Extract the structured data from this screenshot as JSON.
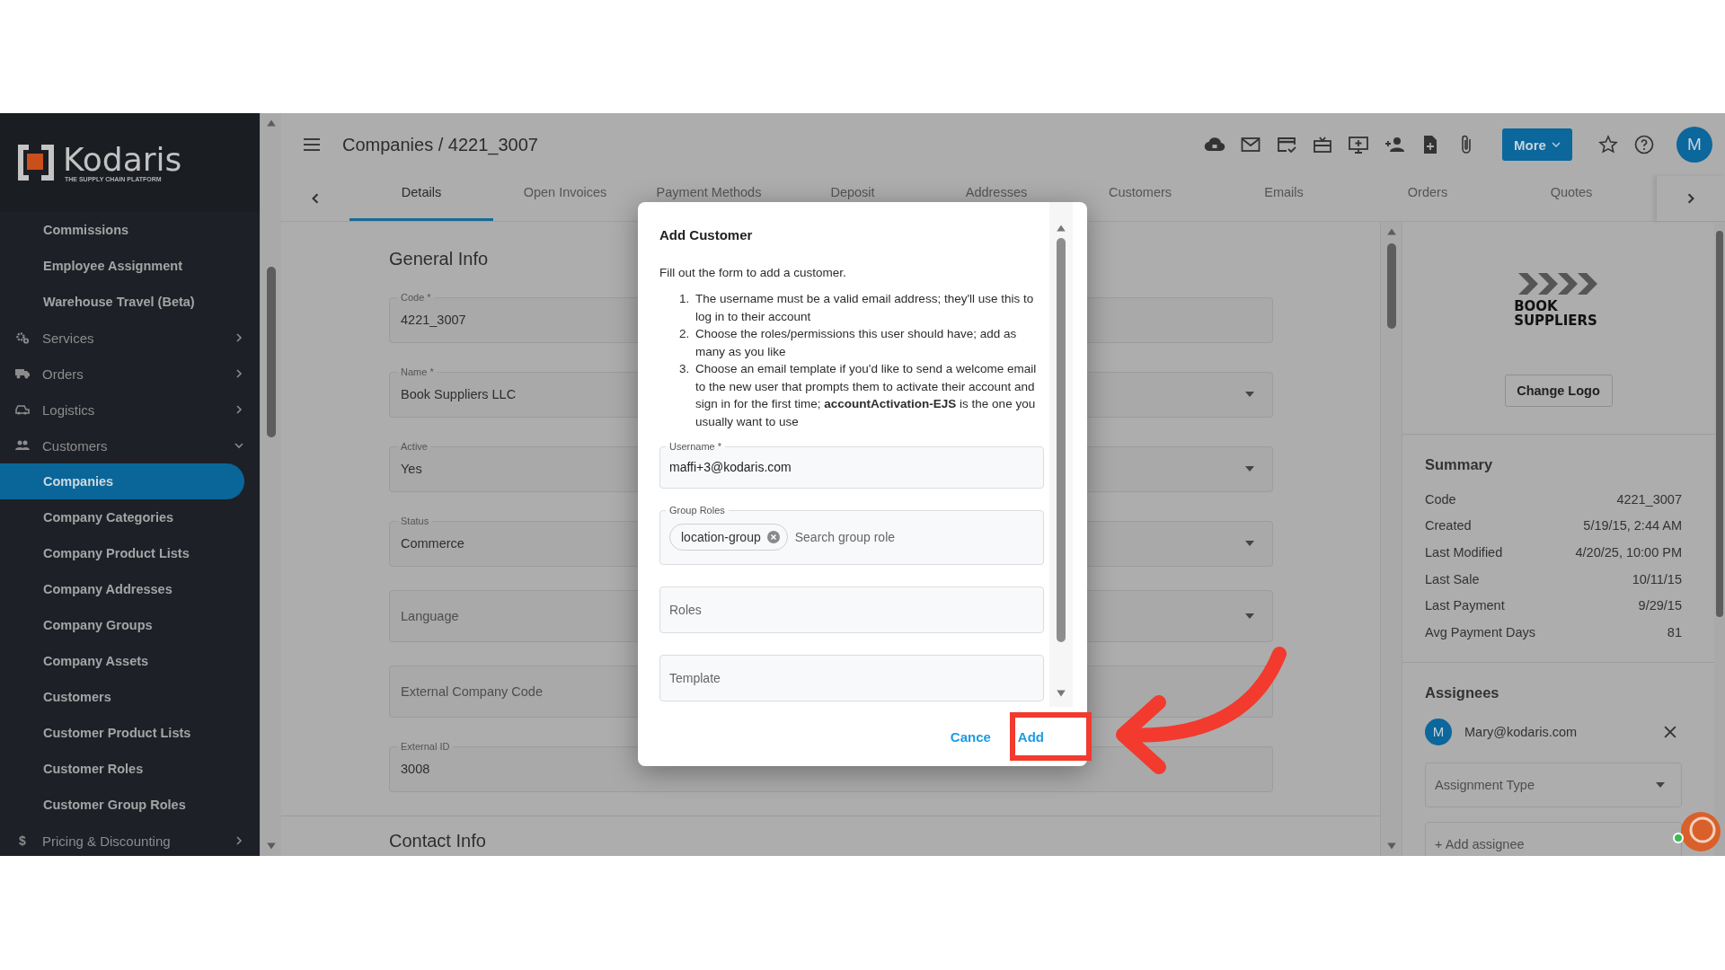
{
  "sidebar": {
    "logo": {
      "name": "Kodaris",
      "tagline": "THE SUPPLY CHAIN PLATFORM"
    },
    "items": [
      {
        "label": "Commissions",
        "kind": "link",
        "selected": false
      },
      {
        "label": "Employee Assignment",
        "kind": "link",
        "selected": false
      },
      {
        "label": "Warehouse Travel (Beta)",
        "kind": "link",
        "selected": false
      },
      {
        "label": "Services",
        "kind": "section",
        "expanded": false
      },
      {
        "label": "Orders",
        "kind": "section",
        "expanded": false
      },
      {
        "label": "Logistics",
        "kind": "section",
        "expanded": false
      },
      {
        "label": "Customers",
        "kind": "section",
        "expanded": true,
        "children": [
          {
            "label": "Companies",
            "kind": "link",
            "selected": true
          },
          {
            "label": "Company Categories",
            "kind": "link",
            "selected": false
          },
          {
            "label": "Company Product Lists",
            "kind": "link",
            "selected": false
          },
          {
            "label": "Company Addresses",
            "kind": "link",
            "selected": false
          },
          {
            "label": "Company Groups",
            "kind": "link",
            "selected": false
          },
          {
            "label": "Company Assets",
            "kind": "link",
            "selected": false
          },
          {
            "label": "Customers",
            "kind": "link",
            "selected": false
          },
          {
            "label": "Customer Product Lists",
            "kind": "link",
            "selected": false
          },
          {
            "label": "Customer Roles",
            "kind": "link",
            "selected": false
          },
          {
            "label": "Customer Group Roles",
            "kind": "link",
            "selected": false
          }
        ]
      },
      {
        "label": "Pricing & Discounting",
        "kind": "section",
        "expanded": false,
        "glyph": "$"
      }
    ]
  },
  "header": {
    "title": "Companies / 4221_3007",
    "more_button": "More",
    "avatar": "M"
  },
  "tabs": [
    {
      "label": "Details",
      "selected": true
    },
    {
      "label": "Open Invoices",
      "selected": false
    },
    {
      "label": "Payment Methods",
      "selected": false
    },
    {
      "label": "Deposit",
      "selected": false
    },
    {
      "label": "Addresses",
      "selected": false
    },
    {
      "label": "Customers",
      "selected": false
    },
    {
      "label": "Emails",
      "selected": false
    },
    {
      "label": "Orders",
      "selected": false
    },
    {
      "label": "Quotes",
      "selected": false
    }
  ],
  "general_info": {
    "title": "General Info",
    "fields": [
      {
        "kind": "text",
        "label": "Code *",
        "value": "4221_3007"
      },
      {
        "kind": "select",
        "label": "Name *",
        "value": "Book Suppliers LLC"
      },
      {
        "kind": "select",
        "label": "Active",
        "value": "Yes"
      },
      {
        "kind": "select",
        "label": "Status",
        "value": "Commerce"
      },
      {
        "kind": "select",
        "placeholder": "Language"
      },
      {
        "kind": "text",
        "placeholder": "External Company Code"
      },
      {
        "kind": "text",
        "label": "External ID",
        "value": "3008"
      }
    ],
    "next_section": "Contact Info"
  },
  "side_panel": {
    "logo": {
      "line_1": "BOOK",
      "line_2": "SUPPLIERS"
    },
    "change_logo_button": "Change Logo",
    "summary": {
      "title": "Summary",
      "rows": [
        {
          "label": "Code",
          "value": "4221_3007"
        },
        {
          "label": "Created",
          "value": "5/19/15, 2:44 AM"
        },
        {
          "label": "Last Modified",
          "value": "4/20/25, 10:00 PM"
        },
        {
          "label": "Last Sale",
          "value": "10/11/15"
        },
        {
          "label": "Last Payment",
          "value": "9/29/15"
        },
        {
          "label": "Avg Payment Days",
          "value": "81"
        }
      ]
    },
    "assignees": {
      "title": "Assignees",
      "items": [
        {
          "avatar": "M",
          "email": "Mary@kodaris.com"
        }
      ],
      "type_placeholder": "Assignment Type",
      "add_placeholder": "+ Add assignee"
    }
  },
  "dialog": {
    "title": "Add Customer",
    "intro": "Fill out the form to add a customer.",
    "steps": [
      {
        "number": "1.",
        "text": "The username must be a valid email address; they'll use this to log in to their account"
      },
      {
        "number": "2.",
        "text": "Choose the roles/permissions this user should have; add as many as you like"
      },
      {
        "number": "3.",
        "text": "Choose an email template if you'd like to send a welcome email to the new user that prompts them to activate their account and sign in for the first time; **accountActivation-EJS** is the one you usually want to use"
      }
    ],
    "username": {
      "label": "Username *",
      "value": "maffi+3@kodaris.com"
    },
    "group_roles": {
      "label": "Group Roles",
      "chips": [
        "location-group"
      ],
      "placeholder": "Search group role"
    },
    "roles": {
      "placeholder": "Roles"
    },
    "template": {
      "placeholder": "Template"
    },
    "cancel_button": "Cance",
    "add_button": "Add"
  }
}
